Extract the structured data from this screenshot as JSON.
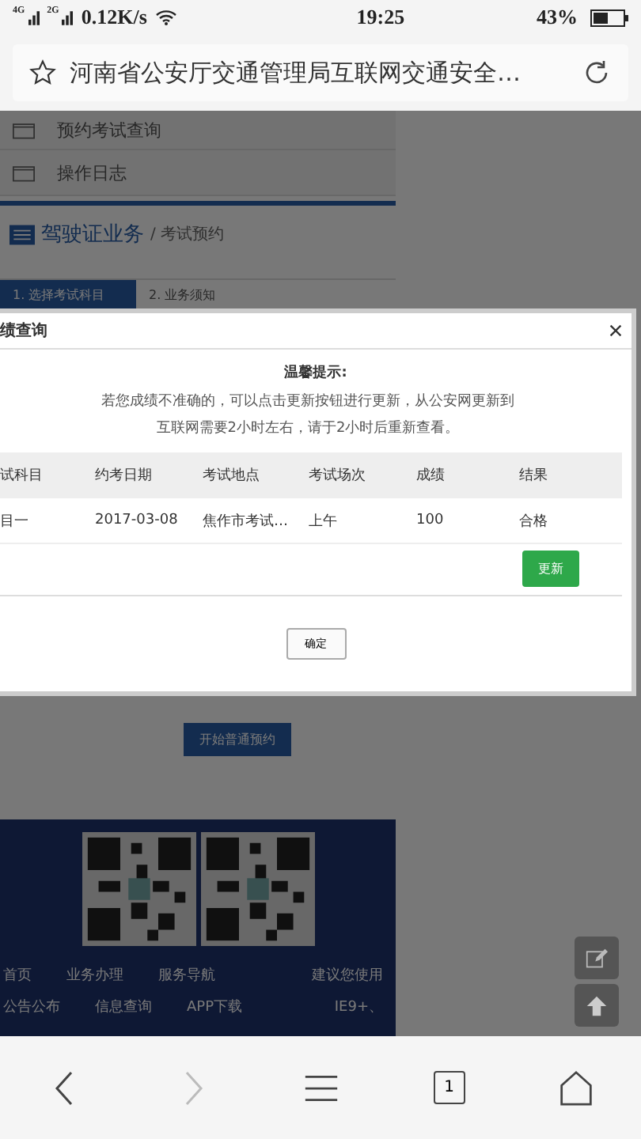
{
  "status_bar": {
    "network_1": "4G",
    "network_2": "2G",
    "speed": "0.12K/s",
    "time": "19:25",
    "battery": "43%"
  },
  "address_bar": {
    "title": "河南省公安厅交通管理局互联网交通安全…"
  },
  "page": {
    "sidebar_items": [
      "预约考试查询",
      "操作日志"
    ],
    "section_title": "驾驶证业务",
    "breadcrumb": "/ 考试预约",
    "steps": [
      {
        "label": "1. 选择考试科目",
        "selected": true
      },
      {
        "label": "2. 业务须知",
        "selected": false
      }
    ],
    "start_button": "开始普通预约",
    "footer_links": [
      [
        "首页",
        "业务办理",
        "服务导航"
      ],
      [
        "公告公布",
        "信息查询",
        "APP下载"
      ]
    ],
    "browser_note": [
      "建议您使用",
      "IE9+、"
    ]
  },
  "modal": {
    "title": "绩查询",
    "tip_title": "温馨提示:",
    "tip_text": "若您成绩不准确的，可以点击更新按钮进行更新，从公安网更新到互联网需要2小时左右，请于2小时后重新查看。",
    "columns": [
      "试科目",
      "约考日期",
      "考试地点",
      "考试场次",
      "成绩",
      "结果"
    ],
    "rows": [
      [
        "目一",
        "2017-03-08",
        "焦作市考试…",
        "上午",
        "100",
        "合格"
      ]
    ],
    "update_button": "更新",
    "ok_button": "确定"
  },
  "nav": {
    "tabs_count": "1"
  }
}
